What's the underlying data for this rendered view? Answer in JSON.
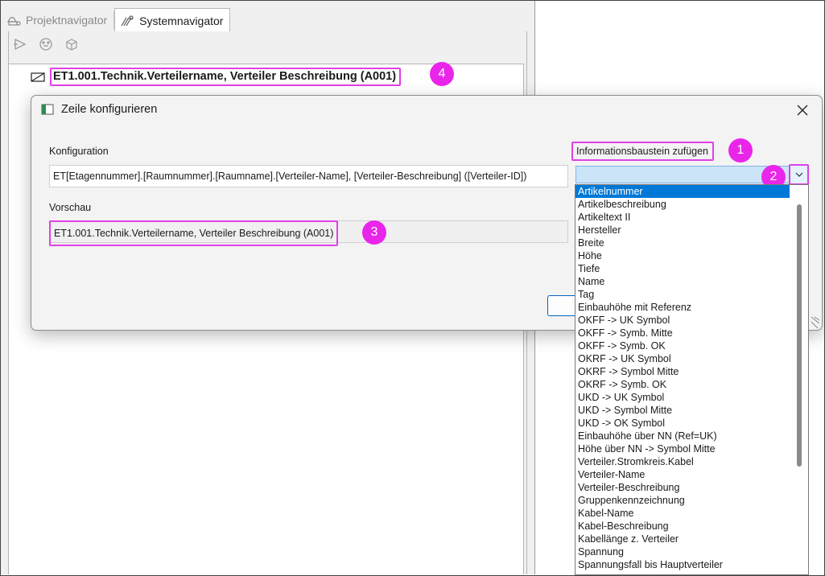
{
  "tabs": [
    {
      "label": "Projektnavigator",
      "active": false,
      "icon": "project-tree-icon"
    },
    {
      "label": "Systemnavigator",
      "active": true,
      "icon": "system-nav-icon"
    }
  ],
  "toolbar": {
    "icons": [
      "play-icon",
      "network-icon",
      "cube-icon"
    ]
  },
  "tree": {
    "row_label": "ET1.001.Technik.Verteilername, Verteiler Beschreibung (A001)",
    "icon": "distributor-symbol-icon"
  },
  "dialog": {
    "title": "Zeile konfigurieren",
    "config_label": "Konfiguration",
    "config_value": "ET[Etagennummer].[Raumnummer].[Raumname].[Verteiler-Name], [Verteiler-Beschreibung] ([Verteiler-ID])",
    "preview_label": "Vorschau",
    "preview_value": "ET1.001.Technik.Verteilername, Verteiler Beschreibung (A001)",
    "info_label": "Informationsbaustein zufügen"
  },
  "badges": {
    "b1": "1",
    "b2": "2",
    "b3": "3",
    "b4": "4"
  },
  "dropdown": {
    "selected_index": 0,
    "items": [
      "Artikelnummer",
      "Artikelbeschreibung",
      "Artikeltext II",
      "Hersteller",
      "Breite",
      "Höhe",
      "Tiefe",
      "Name",
      "Tag",
      "Einbauhöhe mit Referenz",
      "OKFF -> UK Symbol",
      "OKFF -> Symb. Mitte",
      "OKFF -> Symb. OK",
      "OKRF -> UK Symbol",
      "OKRF -> Symbol Mitte",
      "OKRF -> Symb. OK",
      "UKD -> UK Symbol",
      "UKD -> Symbol Mitte",
      "UKD -> OK Symbol",
      "Einbauhöhe über NN (Ref=UK)",
      "Höhe über NN -> Symbol Mitte",
      "Verteiler.Stromkreis.Kabel",
      "Verteiler-Name",
      "Verteiler-Beschreibung",
      "Gruppenkennzeichnung",
      "Kabel-Name",
      "Kabel-Beschreibung",
      "Kabellänge z. Verteiler",
      "Spannung",
      "Spannungsfall bis Hauptverteiler"
    ]
  },
  "colors": {
    "highlight": "#e040e6",
    "badge": "#ea25ea",
    "selection": "#0078d7",
    "combo": "#cce4f7"
  }
}
